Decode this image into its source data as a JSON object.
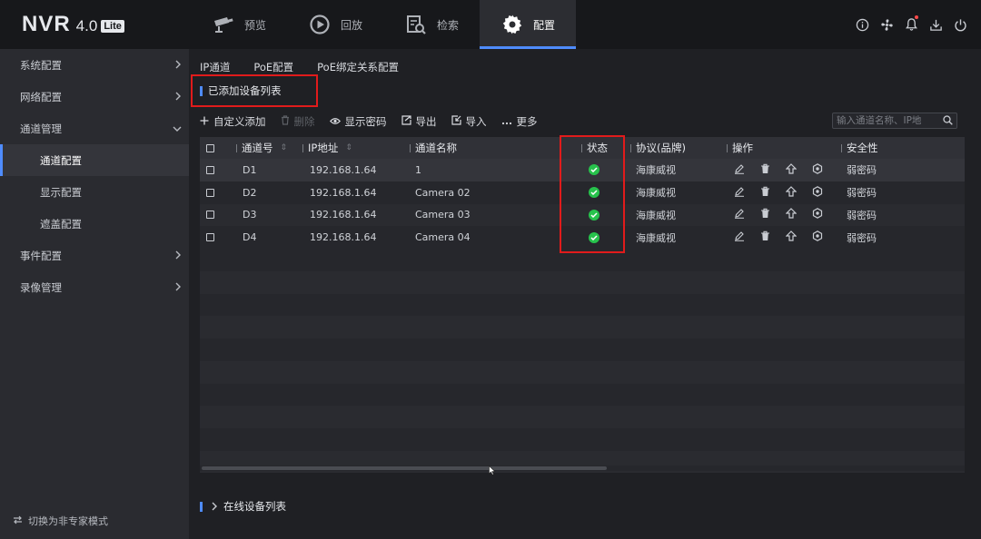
{
  "app": {
    "logo": "NVR",
    "version": "4.0",
    "edition": "Lite"
  },
  "topnav": [
    {
      "label": "预览",
      "icon": "camera-icon"
    },
    {
      "label": "回放",
      "icon": "playback-icon"
    },
    {
      "label": "检索",
      "icon": "search-file-icon"
    },
    {
      "label": "配置",
      "icon": "gear-icon",
      "active": true
    }
  ],
  "top_icons": [
    "info-icon",
    "fan-icon",
    "bell-icon",
    "download-icon",
    "power-icon"
  ],
  "sidebar": {
    "items": [
      {
        "label": "系统配置"
      },
      {
        "label": "网络配置"
      },
      {
        "label": "通道管理"
      },
      {
        "label": "通道配置",
        "active": true
      },
      {
        "label": "显示配置"
      },
      {
        "label": "遮盖配置"
      },
      {
        "label": "事件配置"
      },
      {
        "label": "录像管理"
      }
    ],
    "footer": "切换为非专家模式"
  },
  "subtabs": [
    "IP通道",
    "PoE配置",
    "PoE绑定关系配置"
  ],
  "section_title": "已添加设备列表",
  "toolbar": {
    "add": "自定义添加",
    "delete": "删除",
    "show_password": "显示密码",
    "export": "导出",
    "import": "导入",
    "more": "更多"
  },
  "search": {
    "placeholder": "输入通道名称、IP地"
  },
  "table": {
    "headers": {
      "channel": "通道号",
      "ip": "IP地址",
      "name": "通道名称",
      "status": "状态",
      "protocol": "协议(品牌)",
      "ops": "操作",
      "security": "安全性"
    },
    "rows": [
      {
        "channel": "D1",
        "ip": "192.168.1.64",
        "name": "1",
        "status": "online",
        "protocol": "海康威视",
        "security": "弱密码"
      },
      {
        "channel": "D2",
        "ip": "192.168.1.64",
        "name": "Camera 02",
        "status": "online",
        "protocol": "海康威视",
        "security": "弱密码"
      },
      {
        "channel": "D3",
        "ip": "192.168.1.64",
        "name": "Camera 03",
        "status": "online",
        "protocol": "海康威视",
        "security": "弱密码"
      },
      {
        "channel": "D4",
        "ip": "192.168.1.64",
        "name": "Camera 04",
        "status": "online",
        "protocol": "海康威视",
        "security": "弱密码"
      }
    ]
  },
  "online_list": {
    "label": "在线设备列表"
  },
  "colors": {
    "accent": "#4f8cff",
    "online": "#27c24c",
    "highlight_box": "#e11b1b",
    "background": "#1f2024"
  }
}
